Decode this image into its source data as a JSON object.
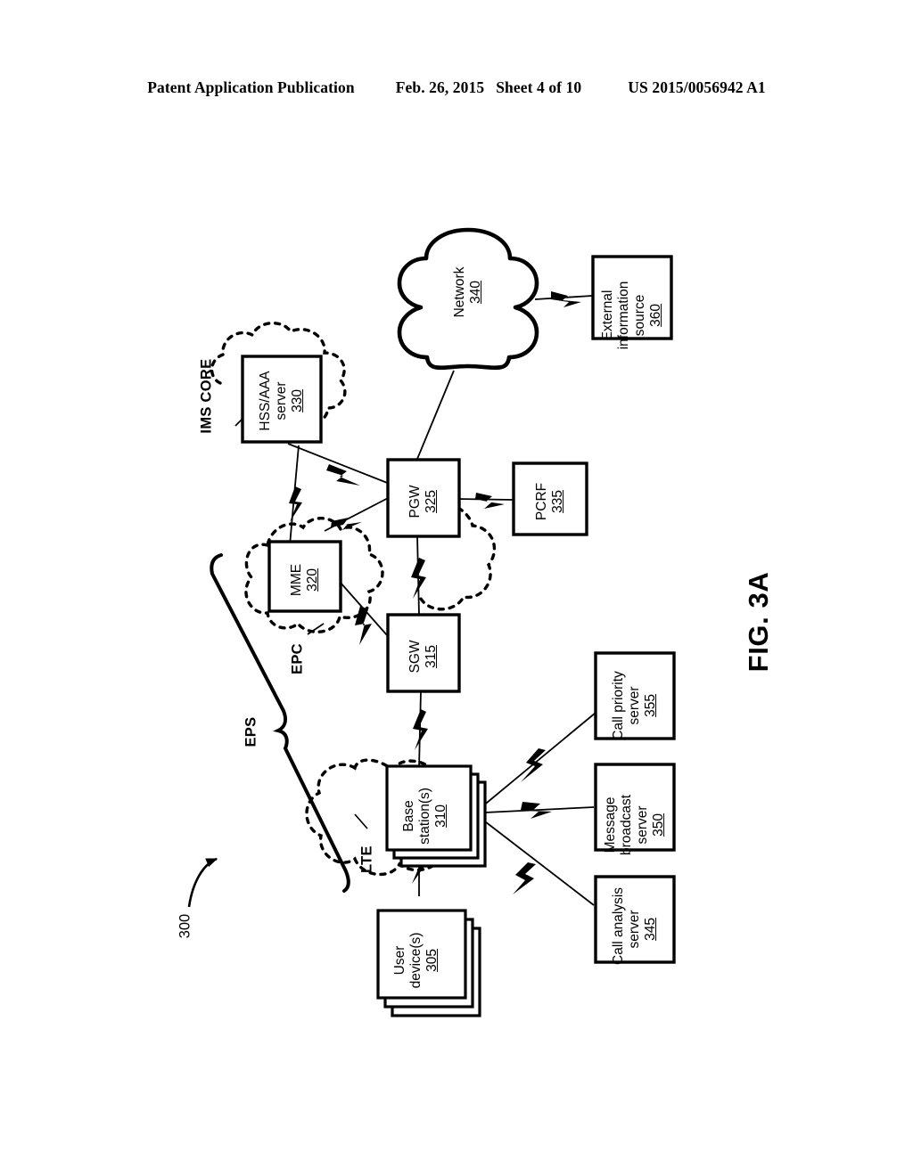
{
  "header": {
    "publication": "Patent Application Publication",
    "date": "Feb. 26, 2015",
    "sheet": "Sheet 4 of 10",
    "doc_number": "US 2015/0056942 A1"
  },
  "figure": {
    "figure_label": "FIG. 3A",
    "reference_numeral": "300",
    "group_labels": {
      "eps": "EPS",
      "epc": "EPC",
      "lte": "LTE",
      "ims_core_line1": "IMS",
      "ims_core_line2": "CORE"
    },
    "nodes": {
      "user_device": {
        "line1": "User",
        "line2": "device(s)",
        "num": "305"
      },
      "base_station": {
        "line1": "Base",
        "line2": "station(s)",
        "num": "310"
      },
      "sgw": {
        "line1": "SGW",
        "num": "315"
      },
      "mme": {
        "line1": "MME",
        "num": "320"
      },
      "pgw": {
        "line1": "PGW",
        "num": "325"
      },
      "hss_aaa": {
        "line1": "HSS/AAA",
        "line2": "server",
        "num": "330"
      },
      "pcrf": {
        "line1": "PCRF",
        "num": "335"
      },
      "network": {
        "line1": "Network",
        "num": "340"
      },
      "call_analysis": {
        "line1": "Call analysis",
        "line2": "server",
        "num": "345"
      },
      "message_broadcast": {
        "line1": "Message",
        "line2": "broadcast",
        "line3": "server",
        "num": "350"
      },
      "call_priority": {
        "line1": "Call priority",
        "line2": "server",
        "num": "355"
      },
      "external_info": {
        "line1": "External",
        "line2": "information",
        "line3": "source",
        "num": "360"
      }
    },
    "colors": {
      "ink": "#000000",
      "paper": "#ffffff"
    }
  }
}
